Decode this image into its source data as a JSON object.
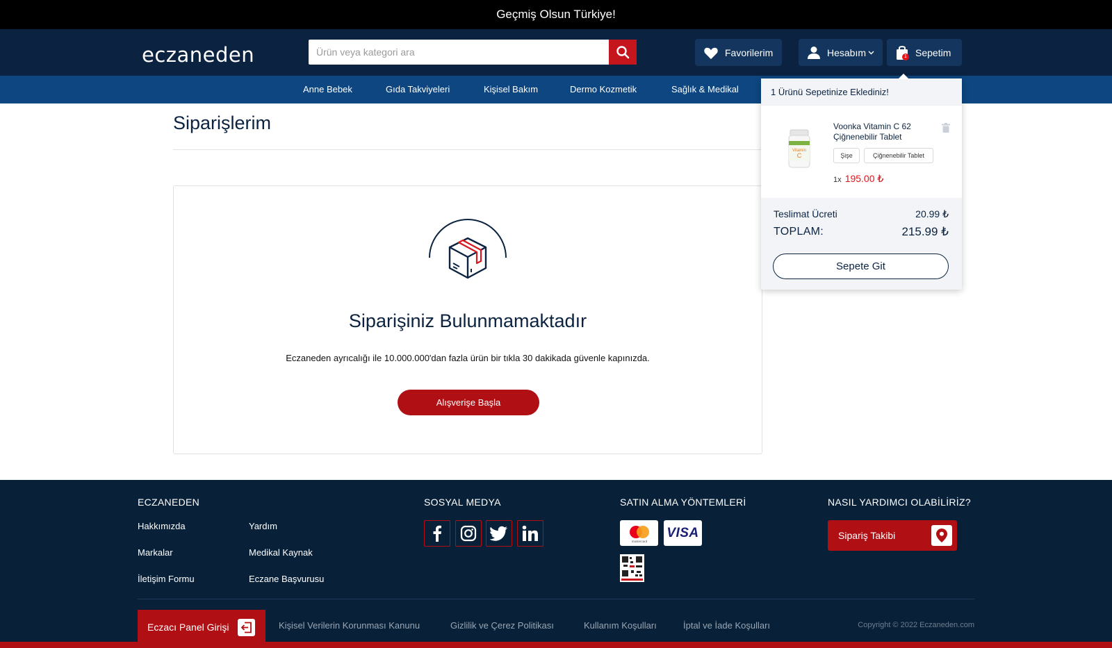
{
  "announcement": "Geçmiş Olsun Türkiye!",
  "header": {
    "logo": "eczaneden",
    "search_placeholder": "Ürün veya kategori ara",
    "favorites": "Favorilerim",
    "account": "Hesabım",
    "cart": "Sepetim",
    "cart_count": "1"
  },
  "categories": [
    "Anne Bebek",
    "Gıda Takviyeleri",
    "Kişisel Bakım",
    "Dermo Kozmetik",
    "Sağlık & Medikal"
  ],
  "page": {
    "title": "Siparişlerim",
    "empty_title": "Siparişiniz Bulunmamaktadır",
    "empty_desc": "Eczaneden ayrıcalığı ile 10.000.000'dan fazla ürün bir tıkla 30 dakikada güvenle kapınızda.",
    "cta": "Alışverişe Başla"
  },
  "mini_cart": {
    "header": "1 Ürünü Sepetinize Eklediniz!",
    "product_name": "Voonka Vitamin C 62 Çiğnenebilir Tablet",
    "chips": [
      "Şişe",
      "Çiğnenebilir Tablet"
    ],
    "qty": "1x",
    "price": "195.00 ₺",
    "shipping_label": "Teslimat Ücreti",
    "shipping_value": "20.99 ₺",
    "total_label": "TOPLAM:",
    "total_value": "215.99 ₺",
    "go_cart": "Sepete Git"
  },
  "footer": {
    "col1_title": "ECZANEDEN",
    "col1_links": [
      "Hakkımızda",
      "Yardım",
      "Markalar",
      "Medikal Kaynak",
      "İletişim Formu",
      "Eczane Başvurusu"
    ],
    "social_title": "SOSYAL MEDYA",
    "social_icons": [
      "facebook-icon",
      "instagram-icon",
      "twitter-icon",
      "linkedin-icon"
    ],
    "payment_title": "SATIN ALMA YÖNTEMLERİ",
    "payment_methods": [
      "mastercard",
      "VISA"
    ],
    "help_title": "NASIL YARDIMCI OLABİLİRİZ?",
    "track_order": "Sipariş Takibi",
    "pharmacist_panel": "Eczacı Panel Girişi",
    "legal_links": [
      "Kişisel Verilerin Korunması Kanunu",
      "Gizlilik ve Çerez Politikası",
      "Kullanım Koşulları",
      "İptal ve İade Koşulları"
    ],
    "copyright": "Copyright © 2022 Eczaneden.com"
  },
  "colors": {
    "navy": "#0b2340",
    "nav_blue": "#0d4681",
    "accent_red": "#b00f14",
    "price_red": "#e2141b"
  }
}
